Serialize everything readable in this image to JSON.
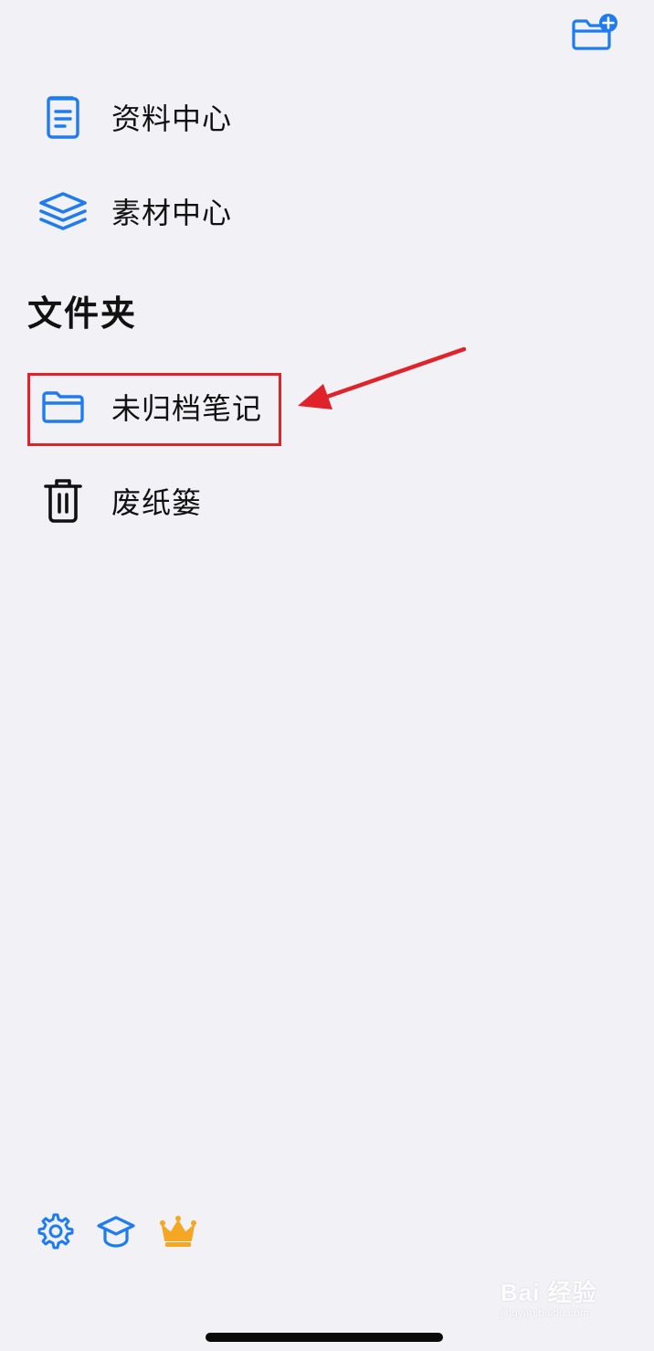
{
  "top_bar": {
    "new_folder_icon": "folder-plus-icon"
  },
  "nav": [
    {
      "label": "资料中心",
      "icon": "document-icon"
    },
    {
      "label": "素材中心",
      "icon": "layers-icon"
    }
  ],
  "folders": {
    "title": "文件夹",
    "items": [
      {
        "label": "未归档笔记",
        "icon": "folder-icon"
      },
      {
        "label": "废纸篓",
        "icon": "trash-icon"
      }
    ]
  },
  "bottom_bar": {
    "icons": [
      "gear-icon",
      "graduation-cap-icon",
      "crown-icon"
    ]
  },
  "watermark": {
    "main": "Bai 经验",
    "sub": "jingyan.baidu.com"
  },
  "colors": {
    "accent": "#1e7cf0",
    "background": "#f2f1f6",
    "highlight": "#e0232b",
    "crown": "#f5a623"
  }
}
